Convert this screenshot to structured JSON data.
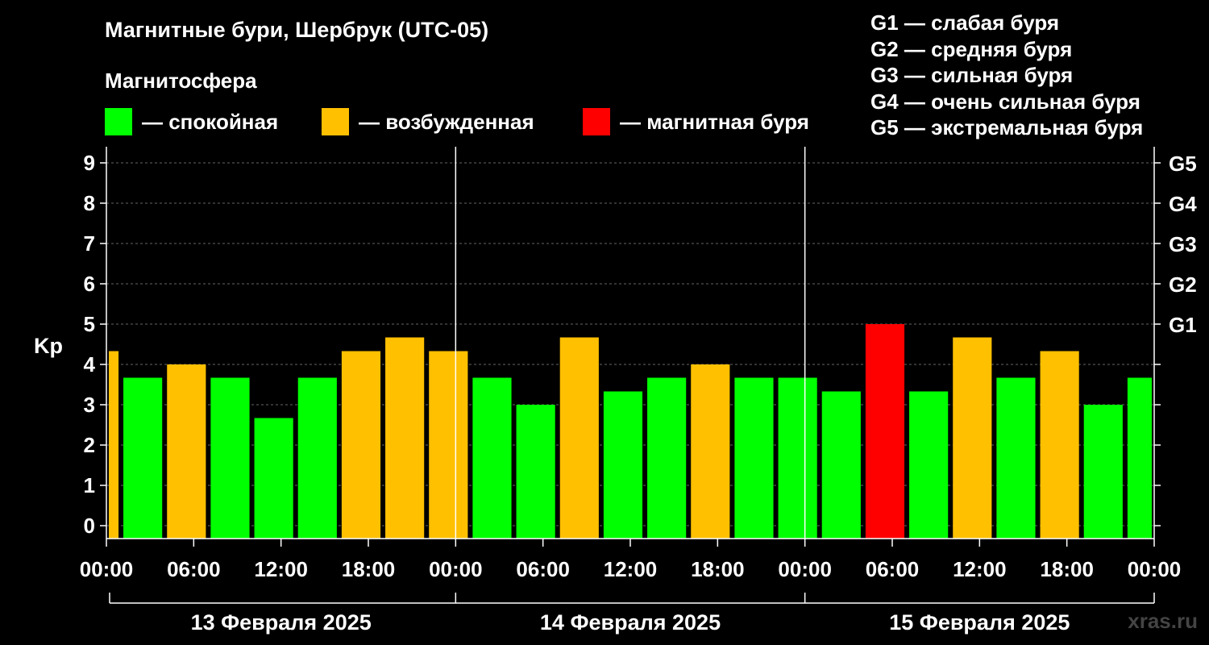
{
  "header": {
    "title": "Магнитные бури, Шербрук (UTC-05)",
    "subtitle": "Магнитосфера"
  },
  "legend": [
    {
      "color": "#00ff00",
      "label": "— спокойная"
    },
    {
      "color": "#ffc000",
      "label": "— возбужденная"
    },
    {
      "color": "#ff0000",
      "label": "— магнитная буря"
    }
  ],
  "storm_scale": [
    "G1 — слабая буря",
    "G2 — средняя буря",
    "G3 — сильная буря",
    "G4 — очень сильная буря",
    "G5 — экстремальная буря"
  ],
  "watermark": "xras.ru",
  "colors": {
    "quiet": "#00ff00",
    "active": "#ffc000",
    "storm": "#ff0000",
    "background": "#000000",
    "foreground": "#ffffff"
  },
  "chart_data": {
    "type": "bar",
    "ylabel": "Kp",
    "ylim": [
      0,
      9
    ],
    "yticks": [
      "0",
      "1",
      "2",
      "3",
      "4",
      "5",
      "6",
      "7",
      "8",
      "9"
    ],
    "right_axis_labels": [
      {
        "value": 5,
        "label": "G1"
      },
      {
        "value": 6,
        "label": "G2"
      },
      {
        "value": 7,
        "label": "G3"
      },
      {
        "value": 8,
        "label": "G4"
      },
      {
        "value": 9,
        "label": "G5"
      }
    ],
    "x_ticks": [
      "00:00",
      "06:00",
      "12:00",
      "18:00",
      "00:00",
      "06:00",
      "12:00",
      "18:00",
      "00:00",
      "06:00",
      "12:00",
      "18:00",
      "00:00"
    ],
    "x_range_hours": [
      0,
      72
    ],
    "days": [
      {
        "label": "13 Февраля 2025",
        "start_hour": 0,
        "end_hour": 24
      },
      {
        "label": "14 Февраля 2025",
        "start_hour": 24,
        "end_hour": 48
      },
      {
        "label": "15 Февраля 2025",
        "start_hour": 48,
        "end_hour": 72
      }
    ],
    "grid": "dashed horizontal at integer Kp; vertical lines at day boundaries",
    "bars": [
      {
        "start_hour": 0,
        "end_hour": 1,
        "kp": 4.33,
        "level": "active"
      },
      {
        "start_hour": 1,
        "end_hour": 4,
        "kp": 3.67,
        "level": "quiet"
      },
      {
        "start_hour": 4,
        "end_hour": 7,
        "kp": 4.0,
        "level": "active"
      },
      {
        "start_hour": 7,
        "end_hour": 10,
        "kp": 3.67,
        "level": "quiet"
      },
      {
        "start_hour": 10,
        "end_hour": 13,
        "kp": 2.67,
        "level": "quiet"
      },
      {
        "start_hour": 13,
        "end_hour": 16,
        "kp": 3.67,
        "level": "quiet"
      },
      {
        "start_hour": 16,
        "end_hour": 19,
        "kp": 4.33,
        "level": "active"
      },
      {
        "start_hour": 19,
        "end_hour": 22,
        "kp": 4.67,
        "level": "active"
      },
      {
        "start_hour": 22,
        "end_hour": 25,
        "kp": 4.33,
        "level": "active"
      },
      {
        "start_hour": 25,
        "end_hour": 28,
        "kp": 3.67,
        "level": "quiet"
      },
      {
        "start_hour": 28,
        "end_hour": 31,
        "kp": 3.0,
        "level": "quiet"
      },
      {
        "start_hour": 31,
        "end_hour": 34,
        "kp": 4.67,
        "level": "active"
      },
      {
        "start_hour": 34,
        "end_hour": 37,
        "kp": 3.33,
        "level": "quiet"
      },
      {
        "start_hour": 37,
        "end_hour": 40,
        "kp": 3.67,
        "level": "quiet"
      },
      {
        "start_hour": 40,
        "end_hour": 43,
        "kp": 4.0,
        "level": "active"
      },
      {
        "start_hour": 43,
        "end_hour": 46,
        "kp": 3.67,
        "level": "quiet"
      },
      {
        "start_hour": 46,
        "end_hour": 49,
        "kp": 3.67,
        "level": "quiet"
      },
      {
        "start_hour": 49,
        "end_hour": 52,
        "kp": 3.33,
        "level": "quiet"
      },
      {
        "start_hour": 52,
        "end_hour": 55,
        "kp": 5.0,
        "level": "storm"
      },
      {
        "start_hour": 55,
        "end_hour": 58,
        "kp": 3.33,
        "level": "quiet"
      },
      {
        "start_hour": 58,
        "end_hour": 61,
        "kp": 4.67,
        "level": "active"
      },
      {
        "start_hour": 61,
        "end_hour": 64,
        "kp": 3.67,
        "level": "quiet"
      },
      {
        "start_hour": 64,
        "end_hour": 67,
        "kp": 4.33,
        "level": "active"
      },
      {
        "start_hour": 67,
        "end_hour": 70,
        "kp": 3.0,
        "level": "quiet"
      },
      {
        "start_hour": 70,
        "end_hour": 72,
        "kp": 3.67,
        "level": "quiet"
      }
    ]
  }
}
